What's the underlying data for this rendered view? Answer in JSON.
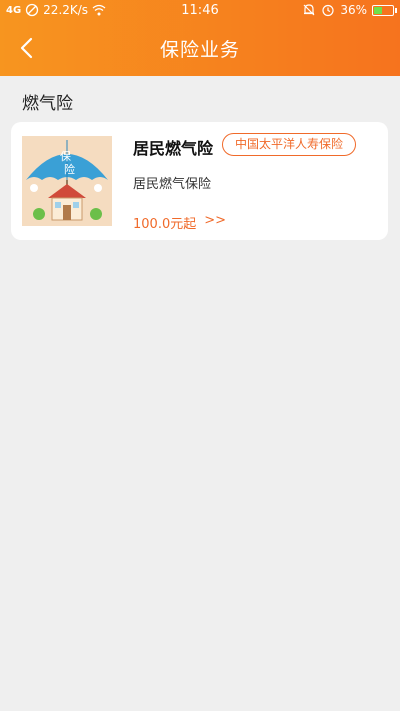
{
  "status_bar": {
    "signal_text": "4G",
    "net_speed": "22.2K/s",
    "time": "11:46",
    "battery": "36%"
  },
  "header": {
    "title": "保险业务",
    "back_icon": "chevron-left-icon"
  },
  "section": {
    "title": "燃气险"
  },
  "product": {
    "name": "居民燃气险",
    "company": "中国太平洋人寿保险",
    "description": "居民燃气保险",
    "price": "100.0元起",
    "more": ">>",
    "thumb_text_1": "保",
    "thumb_text_2": "险"
  },
  "colors": {
    "header_start": "#f7951f",
    "header_end": "#f6731e",
    "accent": "#f06a2a",
    "background": "#efefef"
  }
}
